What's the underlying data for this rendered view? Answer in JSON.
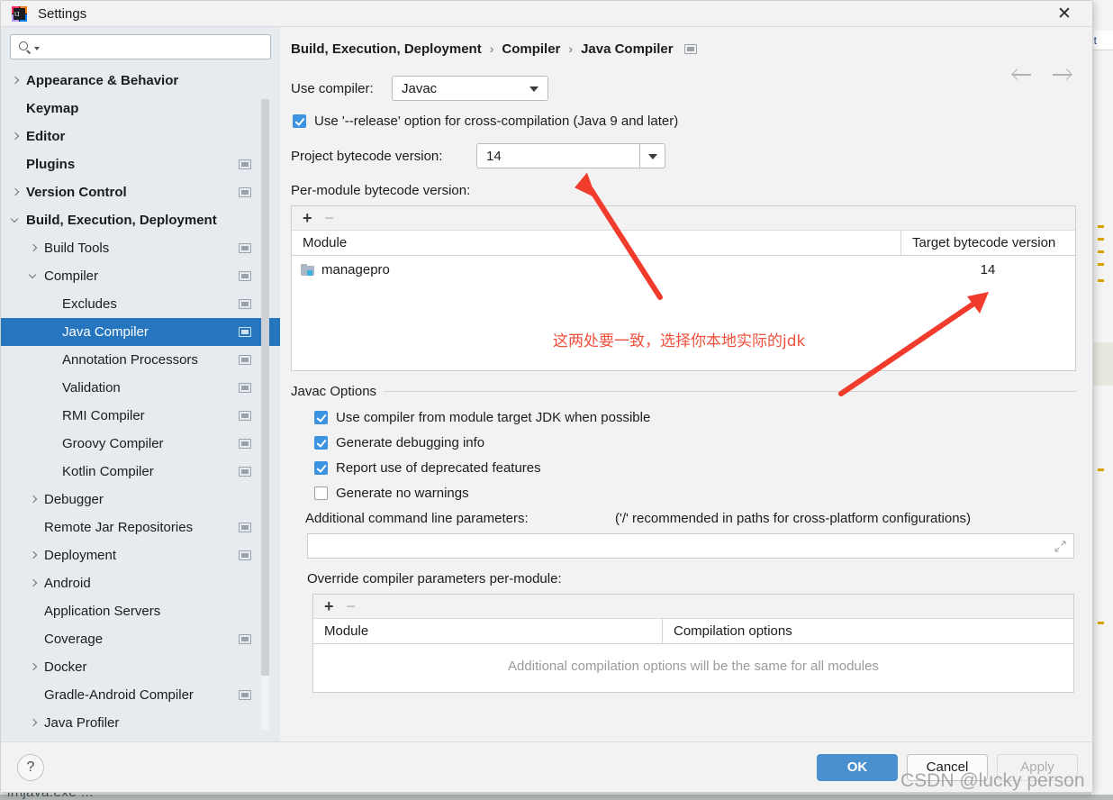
{
  "window": {
    "title": "Settings",
    "app_icon": "intellij-idea-logo",
    "close_label": "✕"
  },
  "search": {
    "placeholder": "",
    "value": "",
    "icon": "search-icon"
  },
  "sidebar": {
    "items": [
      {
        "label": "Appearance & Behavior",
        "indent": 0,
        "twisty": "closed",
        "bold": true,
        "badge": false,
        "selected": false
      },
      {
        "label": "Keymap",
        "indent": 0,
        "twisty": "none",
        "bold": true,
        "badge": false,
        "selected": false
      },
      {
        "label": "Editor",
        "indent": 0,
        "twisty": "closed",
        "bold": true,
        "badge": false,
        "selected": false
      },
      {
        "label": "Plugins",
        "indent": 0,
        "twisty": "none",
        "bold": true,
        "badge": true,
        "selected": false
      },
      {
        "label": "Version Control",
        "indent": 0,
        "twisty": "closed",
        "bold": true,
        "badge": true,
        "selected": false
      },
      {
        "label": "Build, Execution, Deployment",
        "indent": 0,
        "twisty": "open",
        "bold": true,
        "badge": false,
        "selected": false
      },
      {
        "label": "Build Tools",
        "indent": 1,
        "twisty": "closed",
        "bold": false,
        "badge": true,
        "selected": false
      },
      {
        "label": "Compiler",
        "indent": 1,
        "twisty": "open",
        "bold": false,
        "badge": true,
        "selected": false
      },
      {
        "label": "Excludes",
        "indent": 2,
        "twisty": "none",
        "bold": false,
        "badge": true,
        "selected": false
      },
      {
        "label": "Java Compiler",
        "indent": 2,
        "twisty": "none",
        "bold": false,
        "badge": true,
        "selected": true
      },
      {
        "label": "Annotation Processors",
        "indent": 2,
        "twisty": "none",
        "bold": false,
        "badge": true,
        "selected": false
      },
      {
        "label": "Validation",
        "indent": 2,
        "twisty": "none",
        "bold": false,
        "badge": true,
        "selected": false
      },
      {
        "label": "RMI Compiler",
        "indent": 2,
        "twisty": "none",
        "bold": false,
        "badge": true,
        "selected": false
      },
      {
        "label": "Groovy Compiler",
        "indent": 2,
        "twisty": "none",
        "bold": false,
        "badge": true,
        "selected": false
      },
      {
        "label": "Kotlin Compiler",
        "indent": 2,
        "twisty": "none",
        "bold": false,
        "badge": true,
        "selected": false
      },
      {
        "label": "Debugger",
        "indent": 1,
        "twisty": "closed",
        "bold": false,
        "badge": false,
        "selected": false
      },
      {
        "label": "Remote Jar Repositories",
        "indent": 1,
        "twisty": "none",
        "bold": false,
        "badge": true,
        "selected": false
      },
      {
        "label": "Deployment",
        "indent": 1,
        "twisty": "closed",
        "bold": false,
        "badge": true,
        "selected": false
      },
      {
        "label": "Android",
        "indent": 1,
        "twisty": "closed",
        "bold": false,
        "badge": false,
        "selected": false
      },
      {
        "label": "Application Servers",
        "indent": 1,
        "twisty": "none",
        "bold": false,
        "badge": false,
        "selected": false
      },
      {
        "label": "Coverage",
        "indent": 1,
        "twisty": "none",
        "bold": false,
        "badge": true,
        "selected": false
      },
      {
        "label": "Docker",
        "indent": 1,
        "twisty": "closed",
        "bold": false,
        "badge": false,
        "selected": false
      },
      {
        "label": "Gradle-Android Compiler",
        "indent": 1,
        "twisty": "none",
        "bold": false,
        "badge": true,
        "selected": false
      },
      {
        "label": "Java Profiler",
        "indent": 1,
        "twisty": "closed",
        "bold": false,
        "badge": false,
        "selected": false
      }
    ]
  },
  "breadcrumb": {
    "parts": [
      "Build, Execution, Deployment",
      "Compiler",
      "Java Compiler"
    ],
    "separator": "›",
    "badge": "project-scope-badge",
    "back_icon": "arrow-left-icon",
    "forward_icon": "arrow-right-icon"
  },
  "main": {
    "use_compiler_label": "Use compiler:",
    "use_compiler_value": "Javac",
    "release_option_label": "Use '--release' option for cross-compilation (Java 9 and later)",
    "release_option_checked": true,
    "project_bytecode_label": "Project bytecode version:",
    "project_bytecode_value": "14",
    "per_module_label": "Per-module bytecode version:",
    "per_module_table": {
      "add_label": "+",
      "remove_label": "−",
      "columns": [
        "Module",
        "Target bytecode version"
      ],
      "rows": [
        {
          "module": "managepro",
          "target": "14"
        }
      ]
    },
    "javac_options_title": "Javac Options",
    "javac_checkboxes": [
      {
        "label": "Use compiler from module target JDK when possible",
        "checked": true
      },
      {
        "label": "Generate debugging info",
        "checked": true
      },
      {
        "label": "Report use of deprecated features",
        "checked": true
      },
      {
        "label": "Generate no warnings",
        "checked": false
      }
    ],
    "additional_params_label": "Additional command line parameters:",
    "additional_params_hint": "('/' recommended in paths for cross-platform configurations)",
    "additional_params_value": "",
    "expand_icon": "expand-field-icon",
    "override_label": "Override compiler parameters per-module:",
    "override_table": {
      "add_label": "+",
      "remove_label": "−",
      "columns": [
        "Module",
        "Compilation options"
      ],
      "empty_text": "Additional compilation options will be the same for all modules"
    }
  },
  "footer": {
    "help_label": "?",
    "ok_label": "OK",
    "cancel_label": "Cancel",
    "apply_label": "Apply"
  },
  "annotations": {
    "note_text": "这两处要一致，选择你本地实际的jdk",
    "note_color": "#f0503c",
    "arrow_color": "#f03b2d",
    "watermark": "CSDN @lucky person"
  },
  "background": {
    "tab_fragment": "lt",
    "bottom_fragment": "in\\java.exe  ..."
  },
  "colors": {
    "selection_blue": "#2675bf",
    "checkbox_blue": "#3c93e0",
    "ok_button_blue": "#4a90cf",
    "sidebar_bg": "#e6ebf0",
    "content_bg": "#f2f2f2"
  }
}
